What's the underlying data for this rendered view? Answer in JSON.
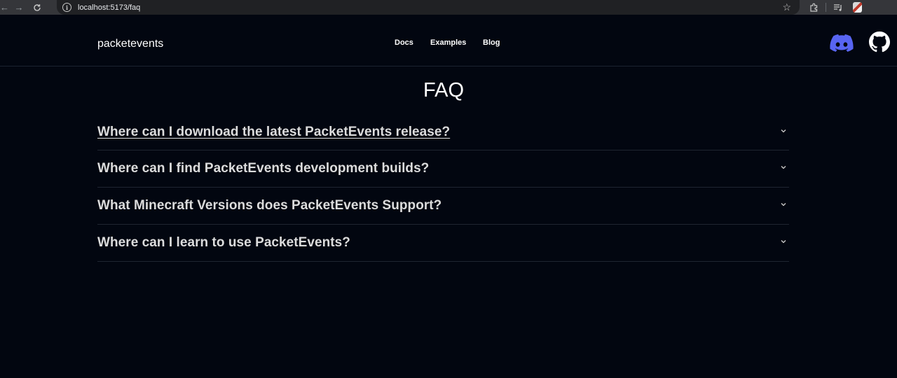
{
  "browser": {
    "url": "localhost:5173/faq"
  },
  "header": {
    "brand": "packetevents",
    "nav": [
      {
        "label": "Docs"
      },
      {
        "label": "Examples"
      },
      {
        "label": "Blog"
      }
    ],
    "icons": [
      "discord-icon",
      "github-icon"
    ],
    "discord_color": "#5865f2"
  },
  "faq": {
    "title": "FAQ",
    "items": [
      {
        "question": "Where can I download the latest PacketEvents release?"
      },
      {
        "question": "Where can I find PacketEvents development builds?"
      },
      {
        "question": "What Minecraft Versions does PacketEvents Support?"
      },
      {
        "question": "Where can I learn to use PacketEvents?"
      }
    ]
  },
  "colors": {
    "background": "#020610",
    "text": "#dcdcdc",
    "divider": "#1f2531"
  }
}
